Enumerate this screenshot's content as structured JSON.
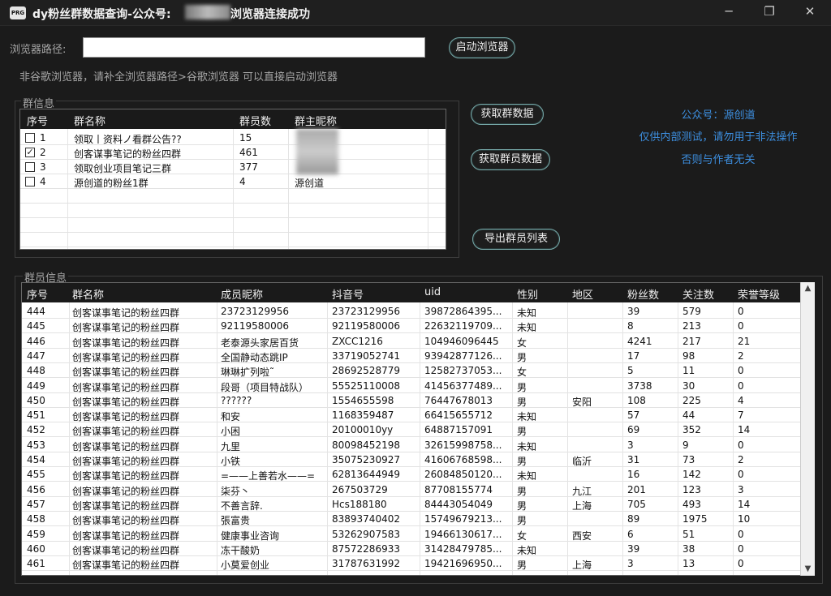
{
  "window": {
    "title": "dy粉丝群数据查询-公众号:",
    "title_tail": "浏览器连接成功",
    "icon_text": "PRG",
    "min_icon": "─",
    "max_icon": "❐",
    "close_icon": "✕"
  },
  "browser": {
    "path_label": "浏览器路径:",
    "path_value": "",
    "launch_button": "启动浏览器",
    "hint": "非谷歌浏览器，请补全浏览器路径>谷歌浏览器 可以直接启动浏览器"
  },
  "group_info": {
    "title": "群信息",
    "columns": [
      "序号",
      "群名称",
      "群员数",
      "群主昵称"
    ],
    "rows": [
      {
        "checked": false,
        "no": "1",
        "name": "领取丨资料ノ看群公告??",
        "count": "15",
        "owner": ""
      },
      {
        "checked": true,
        "no": "2",
        "name": "创客谋事笔记的粉丝四群",
        "count": "461",
        "owner": ""
      },
      {
        "checked": false,
        "no": "3",
        "name": "领取创业项目笔记三群",
        "count": "377",
        "owner": ""
      },
      {
        "checked": false,
        "no": "4",
        "name": "源创道的粉丝1群",
        "count": "4",
        "owner": "源创道"
      }
    ]
  },
  "actions": {
    "get_group": "获取群数据",
    "get_members": "获取群员数据",
    "export": "导出群员列表"
  },
  "notice": {
    "line1": "公众号：源创道",
    "line2": "仅供内部测试，请勿用于非法操作",
    "line3": "否则与作者无关"
  },
  "member_info": {
    "title": "群员信息",
    "columns": [
      "序号",
      "群名称",
      "成员昵称",
      "抖音号",
      "uid",
      "性别",
      "地区",
      "粉丝数",
      "关注数",
      "荣誉等级"
    ],
    "rows": [
      [
        "444",
        "创客谋事笔记的粉丝四群",
        "23723129956",
        "23723129956",
        "39872864395...",
        "未知",
        "",
        "39",
        "579",
        "0"
      ],
      [
        "445",
        "创客谋事笔记的粉丝四群",
        "92119580006",
        "92119580006",
        "22632119709...",
        "未知",
        "",
        "8",
        "213",
        "0"
      ],
      [
        "446",
        "创客谋事笔记的粉丝四群",
        "老泰源头家居百货",
        "ZXCC1216",
        "104946096445",
        "女",
        "",
        "4241",
        "217",
        "21"
      ],
      [
        "447",
        "创客谋事笔记的粉丝四群",
        "全国静动态跳IP",
        "33719052741",
        "93942877126...",
        "男",
        "",
        "17",
        "98",
        "2"
      ],
      [
        "448",
        "创客谋事笔记的粉丝四群",
        "琳琳扩列啦˜",
        "28692528779",
        "12582737053...",
        "女",
        "",
        "5",
        "11",
        "0"
      ],
      [
        "449",
        "创客谋事笔记的粉丝四群",
        "段哥（项目特战队）",
        "55525110008",
        "41456377489...",
        "男",
        "",
        "3738",
        "30",
        "0"
      ],
      [
        "450",
        "创客谋事笔记的粉丝四群",
        "??????",
        "1554655598",
        "76447678013",
        "男",
        "安阳",
        "108",
        "225",
        "4"
      ],
      [
        "451",
        "创客谋事笔记的粉丝四群",
        "和安",
        "1168359487",
        "66415655712",
        "未知",
        "",
        "57",
        "44",
        "7"
      ],
      [
        "452",
        "创客谋事笔记的粉丝四群",
        "小困",
        "20100010yy",
        "64887157091",
        "男",
        "",
        "69",
        "352",
        "14"
      ],
      [
        "453",
        "创客谋事笔记的粉丝四群",
        "九里",
        "80098452198",
        "32615998758...",
        "未知",
        "",
        "3",
        "9",
        "0"
      ],
      [
        "454",
        "创客谋事笔记的粉丝四群",
        "小铁",
        "35075230927",
        "41606768598...",
        "男",
        "临沂",
        "31",
        "73",
        "2"
      ],
      [
        "455",
        "创客谋事笔记的粉丝四群",
        "=——上善若水——=",
        "62813644949",
        "26084850120...",
        "未知",
        "",
        "16",
        "142",
        "0"
      ],
      [
        "456",
        "创客谋事笔记的粉丝四群",
        "柒芬丶",
        "267503729",
        "87708155774",
        "男",
        "九江",
        "201",
        "123",
        "3"
      ],
      [
        "457",
        "创客谋事笔记的粉丝四群",
        "不善言辞.",
        "Hcs188180",
        "84443054049",
        "男",
        "上海",
        "705",
        "493",
        "14"
      ],
      [
        "458",
        "创客谋事笔记的粉丝四群",
        "張富贵",
        "83893740402",
        "15749679213...",
        "男",
        "",
        "89",
        "1975",
        "10"
      ],
      [
        "459",
        "创客谋事笔记的粉丝四群",
        "健康事业咨询",
        "53262907583",
        "19466130617...",
        "女",
        "西安",
        "6",
        "51",
        "0"
      ],
      [
        "460",
        "创客谋事笔记的粉丝四群",
        "冻干酸奶",
        "87572286933",
        "31428479785...",
        "未知",
        "",
        "39",
        "38",
        "0"
      ],
      [
        "461",
        "创客谋事笔记的粉丝四群",
        "小莫爱创业",
        "31787631992",
        "19421696950...",
        "男",
        "上海",
        "3",
        "13",
        "0"
      ]
    ]
  },
  "scroll": {
    "up_icon": "▲",
    "down_icon": "▼"
  }
}
